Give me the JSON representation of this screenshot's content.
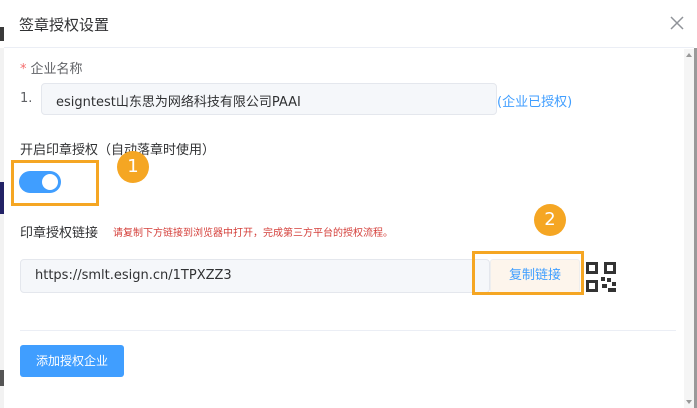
{
  "dialog": {
    "title": "签章授权设置",
    "close_icon": "close-icon"
  },
  "company": {
    "required_mark": "*",
    "label": "企业名称",
    "rows": [
      {
        "index": "1.",
        "name": "esigntest山东思为网络科技有限公司PAAI",
        "status": "(企业已授权)"
      }
    ]
  },
  "seal_auth": {
    "label": "开启印章授权（自动落章时使用）",
    "enabled": true
  },
  "link": {
    "label": "印章授权链接",
    "hint": "请复制下方链接到浏览器中打开，完成第三方平台的授权流程。",
    "url": "https://smlt.esign.cn/1TPXZZ3",
    "copy_label": "复制链接",
    "qr_icon": "qr-code-icon"
  },
  "annotations": {
    "badge_1": "1",
    "badge_2": "2",
    "color": "#f5a623"
  },
  "footer": {
    "add_label": "添加授权企业"
  },
  "colors": {
    "primary": "#409eff",
    "hint": "#d43f3a",
    "required": "#f56c6c"
  }
}
